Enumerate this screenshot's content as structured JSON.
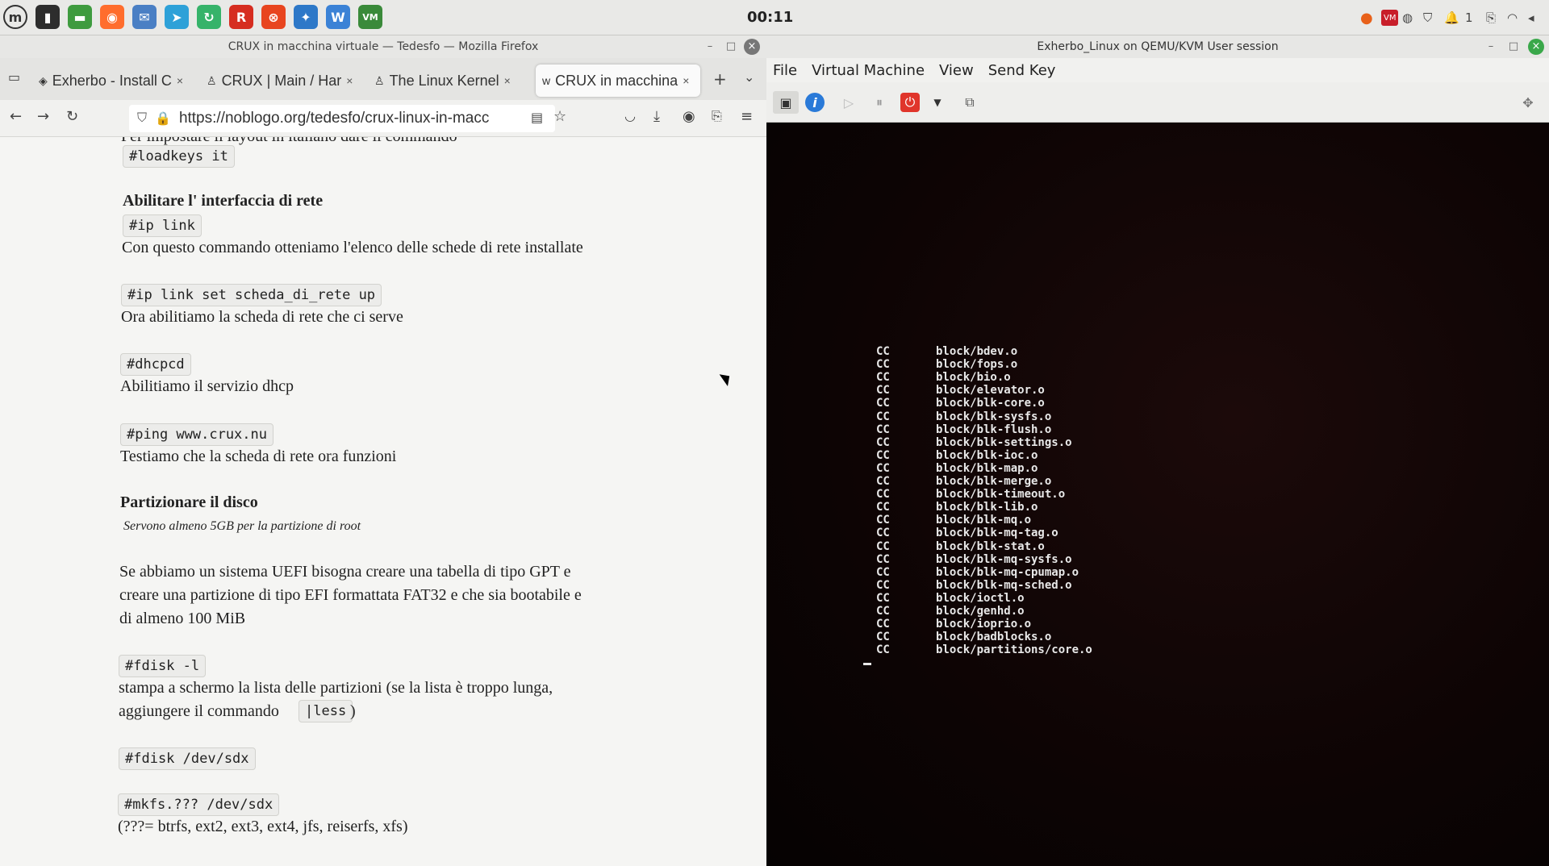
{
  "panel": {
    "clock": "00:11",
    "launchers": [
      {
        "icon": "mint-menu-icon",
        "glyph": "m",
        "color": "#3a3a3a"
      },
      {
        "icon": "terminal-icon",
        "glyph": "▮",
        "color": "#2d2d2d"
      },
      {
        "icon": "files-icon",
        "glyph": "▬",
        "color": "#3f9b3f"
      },
      {
        "icon": "firefox-icon",
        "glyph": "◉",
        "color": "#ff6d2d"
      },
      {
        "icon": "mail-icon",
        "glyph": "✉",
        "color": "#4a7fc4"
      },
      {
        "icon": "telegram-icon",
        "glyph": "➤",
        "color": "#2ea1d8"
      },
      {
        "icon": "sync-icon",
        "glyph": "↻",
        "color": "#36b36a"
      },
      {
        "icon": "r-app-icon",
        "glyph": "R",
        "color": "#d62d20"
      },
      {
        "icon": "stop-app-icon",
        "glyph": "⊗",
        "color": "#e8451f"
      },
      {
        "icon": "network-app-icon",
        "glyph": "✦",
        "color": "#2d78c8"
      },
      {
        "icon": "monitor-app-icon",
        "glyph": "W",
        "color": "#3b82d6"
      },
      {
        "icon": "vm-badge-icon",
        "glyph": "VM",
        "color": "#3a8a3a"
      }
    ],
    "tray": [
      "●",
      "VM",
      "◍",
      "⛉",
      "🔔",
      "1",
      "⎘",
      "◠",
      "◂"
    ]
  },
  "firefox": {
    "title": "CRUX in macchina virtuale — Tedesfo — Mozilla Firefox",
    "tabs": [
      {
        "label": "Exherbo - Install C",
        "active": false
      },
      {
        "label": "CRUX | Main / Har",
        "active": false
      },
      {
        "label": "The Linux Kernel",
        "active": false
      },
      {
        "label": "CRUX in macchina",
        "active": true
      }
    ],
    "url": "https://noblogo.org/tedesfo/crux-linux-in-macc",
    "content": {
      "cut_line": "Per impostare il layout in italiano dare il commando",
      "loadkeys": "#loadkeys it",
      "h_network": "Abilitare l' interfaccia di rete",
      "ip_link": "#ip link",
      "ip_link_desc": "Con questo commando otteniamo l'elenco delle schede di rete installate",
      "ip_link_set": "#ip link set scheda_di_rete up",
      "ip_link_set_desc": "Ora abilitiamo la scheda di rete che ci serve",
      "dhcpcd": "#dhcpcd",
      "dhcpcd_desc": "Abilitiamo il servizio dhcp",
      "ping": "#ping www.crux.nu",
      "ping_desc": "Testiamo che la scheda di rete ora funzioni",
      "h_disk": "Partizionare il disco",
      "disk_note": "Servono almeno 5GB per la partizione di root",
      "uefi_1": "Se abbiamo un sistema UEFI bisogna creare una tabella di tipo GPT e",
      "uefi_2": "creare una partizione di tipo EFI formattata FAT32 e che sia bootabile e",
      "uefi_3": "di almeno 100 MiB",
      "fdisk_l": "#fdisk -l",
      "fdisk_l_desc_1": "stampa a schermo la lista delle partizioni (se la lista è troppo lunga,",
      "fdisk_l_desc_2a": "aggiungere il commando",
      "less": "|less",
      "fdisk_l_desc_2b": ")",
      "fdisk_dev": "#fdisk /dev/sdx",
      "mkfs": "#mkfs.??? /dev/sdx",
      "mkfs_desc": "(???= btrfs, ext2, ext3, ext4, jfs, reiserfs, xfs)"
    }
  },
  "vm": {
    "title": "Exherbo_Linux on QEMU/KVM User session",
    "menu": [
      "File",
      "Virtual Machine",
      "View",
      "Send Key"
    ],
    "terminal": {
      "prefix": "CC",
      "files": [
        "block/bdev.o",
        "block/fops.o",
        "block/bio.o",
        "block/elevator.o",
        "block/blk-core.o",
        "block/blk-sysfs.o",
        "block/blk-flush.o",
        "block/blk-settings.o",
        "block/blk-ioc.o",
        "block/blk-map.o",
        "block/blk-merge.o",
        "block/blk-timeout.o",
        "block/blk-lib.o",
        "block/blk-mq.o",
        "block/blk-mq-tag.o",
        "block/blk-stat.o",
        "block/blk-mq-sysfs.o",
        "block/blk-mq-cpumap.o",
        "block/blk-mq-sched.o",
        "block/ioctl.o",
        "block/genhd.o",
        "block/ioprio.o",
        "block/badblocks.o",
        "block/partitions/core.o"
      ]
    }
  }
}
